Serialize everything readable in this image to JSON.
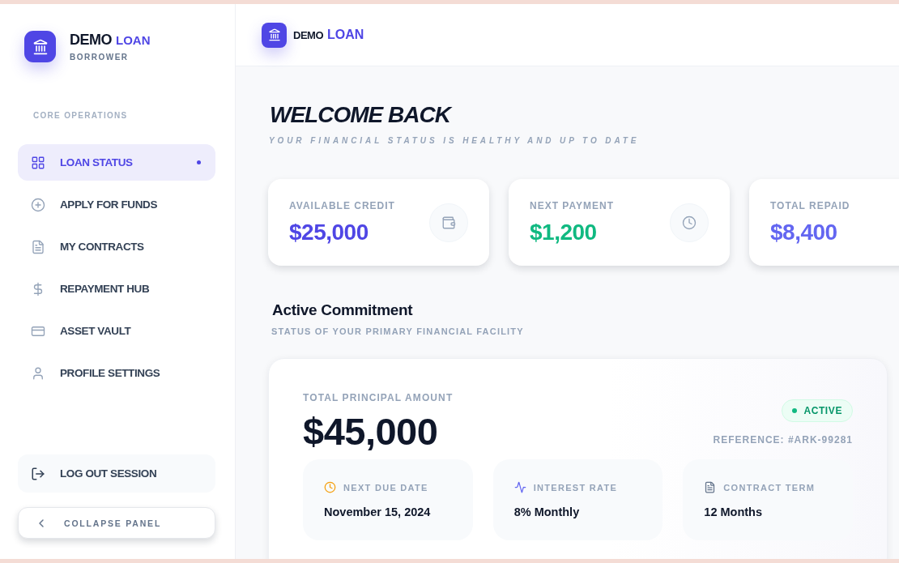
{
  "sidebar": {
    "brand": {
      "name": "DEMO",
      "accent": "LOAN",
      "role": "BORROWER"
    },
    "section_label": "CORE OPERATIONS",
    "items": [
      {
        "label": "LOAN STATUS",
        "selected": true
      },
      {
        "label": "APPLY FOR FUNDS",
        "selected": false
      },
      {
        "label": "MY CONTRACTS",
        "selected": false
      },
      {
        "label": "REPAYMENT HUB",
        "selected": false
      },
      {
        "label": "ASSET VAULT",
        "selected": false
      },
      {
        "label": "PROFILE SETTINGS",
        "selected": false
      }
    ],
    "logout": "LOG OUT SESSION",
    "collapse": "COLLAPSE PANEL"
  },
  "header": {
    "brand": {
      "name": "DEMO",
      "accent": "LOAN"
    }
  },
  "welcome": {
    "title": "WELCOME BACK",
    "subtitle": "YOUR FINANCIAL STATUS IS HEALTHY AND UP TO DATE"
  },
  "stats": [
    {
      "label": "AVAILABLE CREDIT",
      "value": "$25,000",
      "color": "#4f46e5"
    },
    {
      "label": "NEXT PAYMENT",
      "value": "$1,200",
      "color": "#10b981"
    },
    {
      "label": "TOTAL REPAID",
      "value": "$8,400",
      "color": "#6366f1"
    }
  ],
  "commitment": {
    "title": "Active Commitment",
    "subtitle": "STATUS OF YOUR PRIMARY FINANCIAL FACILITY",
    "principal_label": "TOTAL PRINCIPAL AMOUNT",
    "principal": "$45,000",
    "status": "ACTIVE",
    "reference": "REFERENCE: #ARK-99281",
    "details": [
      {
        "label": "NEXT DUE DATE",
        "value": "November 15, 2024"
      },
      {
        "label": "INTEREST RATE",
        "value": "8% Monthly"
      },
      {
        "label": "CONTRACT TERM",
        "value": "12 Months"
      }
    ]
  }
}
